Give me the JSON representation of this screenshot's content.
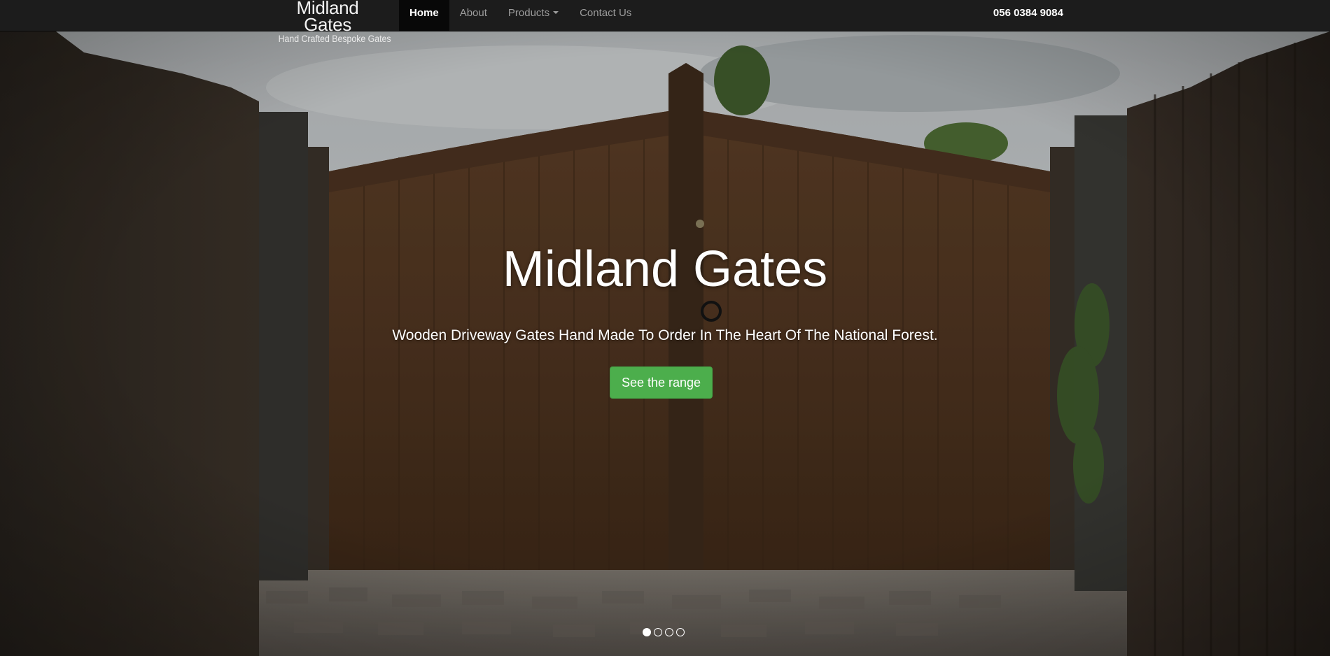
{
  "brand": {
    "title": "Midland Gates",
    "tagline": "Hand Crafted Bespoke Gates"
  },
  "nav": {
    "items": [
      {
        "label": "Home",
        "active": true
      },
      {
        "label": "About"
      },
      {
        "label": "Products",
        "has_dropdown": true,
        "icon": "caret-down-icon"
      },
      {
        "label": "Contact Us"
      }
    ],
    "phone": "056 0384 9084"
  },
  "hero": {
    "title": "Midland Gates",
    "subtitle": "Wooden Driveway Gates Hand Made To Order In The Heart Of The National Forest.",
    "cta_label": "See the range",
    "slides": 4,
    "active_slide": 1,
    "colors": {
      "cta": "#4cae4c",
      "navbar": "#1c1c1c"
    }
  }
}
